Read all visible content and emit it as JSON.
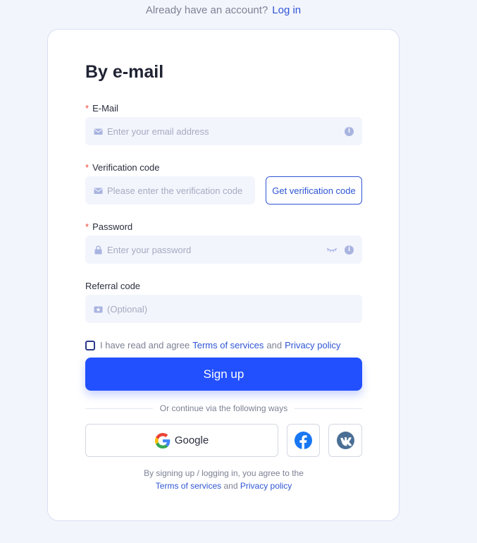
{
  "header": {
    "prompt": "Already have an account?",
    "login_link": "Log in"
  },
  "form": {
    "title": "By e-mail",
    "email": {
      "label": "E-Mail",
      "placeholder": "Enter your email address"
    },
    "verification": {
      "label": "Verification code",
      "placeholder": "Please enter the verification code",
      "button": "Get verification code"
    },
    "password": {
      "label": "Password",
      "placeholder": "Enter your password"
    },
    "referral": {
      "label": "Referral code",
      "placeholder": "(Optional)"
    },
    "required_mark": "*",
    "agree": {
      "text_before": "I have read and agree",
      "terms": "Terms of services",
      "and": "and",
      "privacy": "Privacy policy"
    },
    "signup_button": "Sign up"
  },
  "social": {
    "divider_text": "Or continue via the following ways",
    "google_label": "Google",
    "icons": [
      "google-icon",
      "facebook-icon",
      "vk-icon"
    ]
  },
  "legal": {
    "text": "By signing up / logging in, you agree to the",
    "terms": "Terms of services",
    "and": "and",
    "privacy": "Privacy policy"
  },
  "colors": {
    "accent": "#2250ff",
    "link": "#2f55d4",
    "required": "#f5473a",
    "background": "#f3f5fd"
  }
}
